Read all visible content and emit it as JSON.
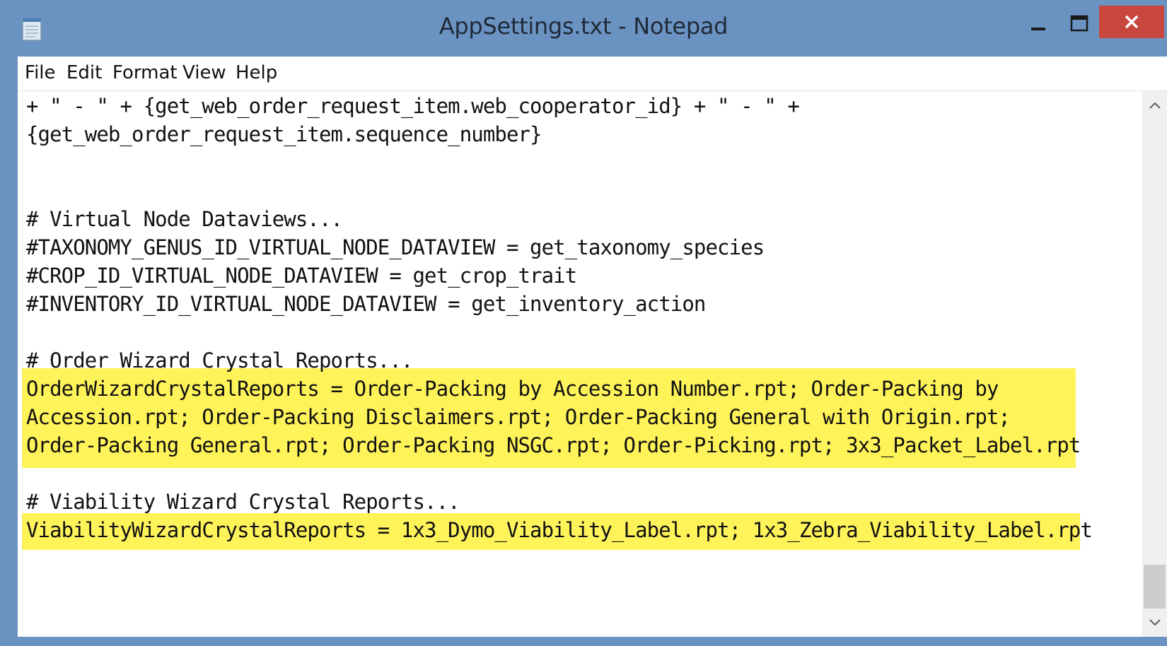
{
  "window": {
    "title": "AppSettings.txt - Notepad",
    "frame_color": "#6b93c2",
    "close_color": "#c7463e"
  },
  "icons": {
    "app": "notepad-icon",
    "minimize": "minimize-icon",
    "maximize": "maximize-icon",
    "close": "close-icon",
    "scroll_up": "chevron-up-icon",
    "scroll_down": "chevron-down-icon"
  },
  "menu": {
    "file": "File",
    "edit": "Edit",
    "format": "Format",
    "view": "View",
    "help": "Help"
  },
  "editor": {
    "highlight_color": "#fff35a",
    "lines": [
      "+ \" - \" + {get_web_order_request_item.web_cooperator_id} + \" - \" +",
      "{get_web_order_request_item.sequence_number}",
      "",
      "",
      "# Virtual Node Dataviews...",
      "#TAXONOMY_GENUS_ID_VIRTUAL_NODE_DATAVIEW = get_taxonomy_species",
      "#CROP_ID_VIRTUAL_NODE_DATAVIEW = get_crop_trait",
      "#INVENTORY_ID_VIRTUAL_NODE_DATAVIEW = get_inventory_action",
      "",
      "# Order Wizard Crystal Reports...",
      "OrderWizardCrystalReports = Order-Packing by Accession Number.rpt; Order-Packing by",
      "Accession.rpt; Order-Packing Disclaimers.rpt; Order-Packing General with Origin.rpt;",
      "Order-Packing General.rpt; Order-Packing NSGC.rpt; Order-Picking.rpt; 3x3_Packet_Label.rpt",
      "",
      "# Viability Wizard Crystal Reports...",
      "ViabilityWizardCrystalReports = 1x3_Dymo_Viability_Label.rpt; 1x3_Zebra_Viability_Label.rpt"
    ]
  }
}
